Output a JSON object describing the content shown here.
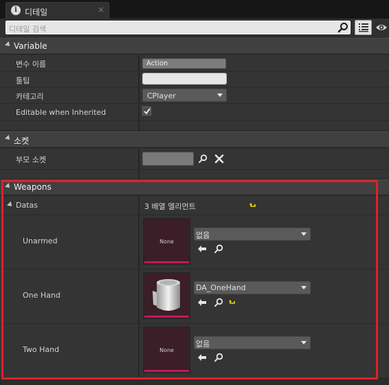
{
  "tab": {
    "icon": "info-icon",
    "title": "디테일",
    "close": "×"
  },
  "search": {
    "placeholder": "디테일 검색"
  },
  "categories": {
    "variable": "Variable",
    "socket": "소켓",
    "weapons": "Weapons"
  },
  "variable": {
    "name_label": "변수 이름",
    "name_value": "Action",
    "tooltip_label": "툴팁",
    "tooltip_value": "",
    "category_label": "카테고리",
    "category_value": "CPlayer",
    "editable_label": "Editable when Inherited",
    "editable_checked": true
  },
  "socket": {
    "parent_label": "부모 소켓",
    "parent_value": ""
  },
  "weapons": {
    "datas_label": "Datas",
    "datas_summary": "3 배열 엘리먼트",
    "elements": [
      {
        "label": "Unarmed",
        "thumb_text": "None",
        "asset": "없음",
        "has_reset": false,
        "has_asset": false
      },
      {
        "label": "One Hand",
        "thumb_text": "",
        "asset": "DA_OneHand",
        "has_reset": true,
        "has_asset": true
      },
      {
        "label": "Two Hand",
        "thumb_text": "None",
        "asset": "없음",
        "has_reset": false,
        "has_asset": false
      }
    ]
  },
  "colors": {
    "highlight_box": "#e0202a",
    "thumb_accent": "#c2185b"
  }
}
